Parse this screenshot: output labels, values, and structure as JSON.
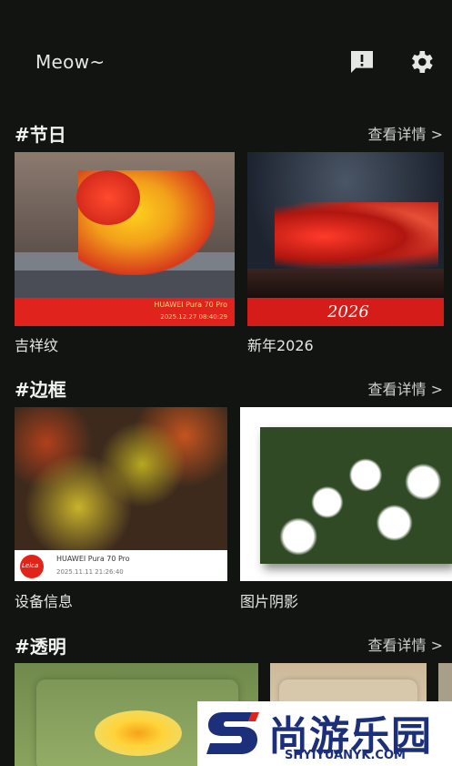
{
  "header": {
    "title": "Meow~",
    "icons": [
      "feedback-icon",
      "settings-icon"
    ]
  },
  "sections": [
    {
      "title": "#节日",
      "link": "查看详情 >",
      "cards": [
        {
          "label": "吉祥纹",
          "meta_line1": "HUAWEI Pura 70 Pro",
          "meta_line2": "2025.12.27 08:40:29"
        },
        {
          "label": "新年2026",
          "banner_text": "2026"
        }
      ]
    },
    {
      "title": "#边框",
      "link": "查看详情 >",
      "cards": [
        {
          "label": "设备信息",
          "logo_text": "Leica",
          "meta_line1": "HUAWEI Pura 70 Pro",
          "meta_line2": "2025.11.11 21:26:40"
        },
        {
          "label": "图片阴影"
        }
      ]
    },
    {
      "title": "#透明",
      "link": "查看详情 >"
    }
  ],
  "watermark": {
    "name": "尚游乐园",
    "url": "SHYIYUANYK.COM"
  },
  "colors": {
    "background": "#121411",
    "accent_red": "#e0231c",
    "watermark_blue": "#1b2f7a"
  }
}
